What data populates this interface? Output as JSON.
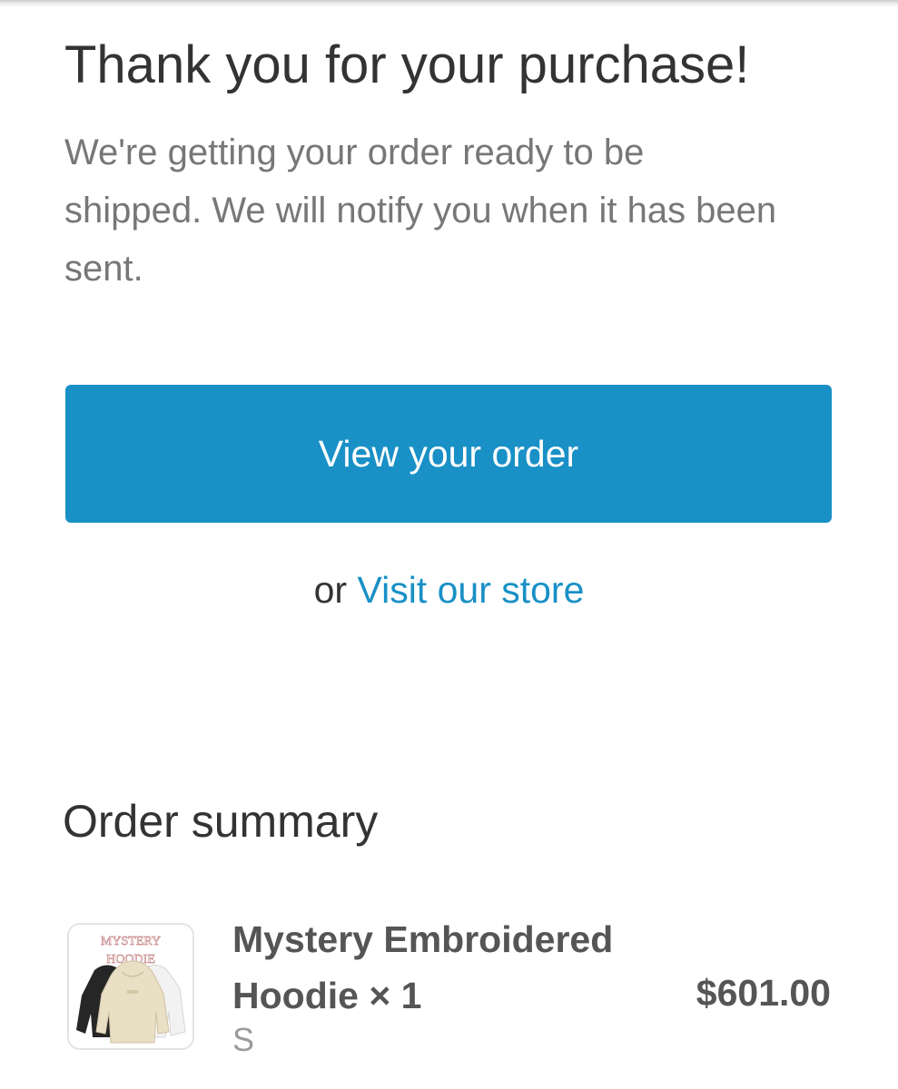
{
  "confirmation": {
    "title": "Thank you for your purchase!",
    "message": "We're getting your order ready to be shipped. We will notify you when it has been sent."
  },
  "actions": {
    "view_order_label": "View your order",
    "or_text": "or",
    "visit_store_label": "Visit our store"
  },
  "order_summary": {
    "heading": "Order summary",
    "items": [
      {
        "name": "Mystery Embroidered Hoodie × 1",
        "variant": "S",
        "price": "$601.00",
        "image_label_line1": "MYSTERY",
        "image_label_line2": "HOODIE"
      }
    ]
  },
  "colors": {
    "accent": "#1990c6",
    "title_text": "#333333",
    "muted_text": "#777777"
  }
}
